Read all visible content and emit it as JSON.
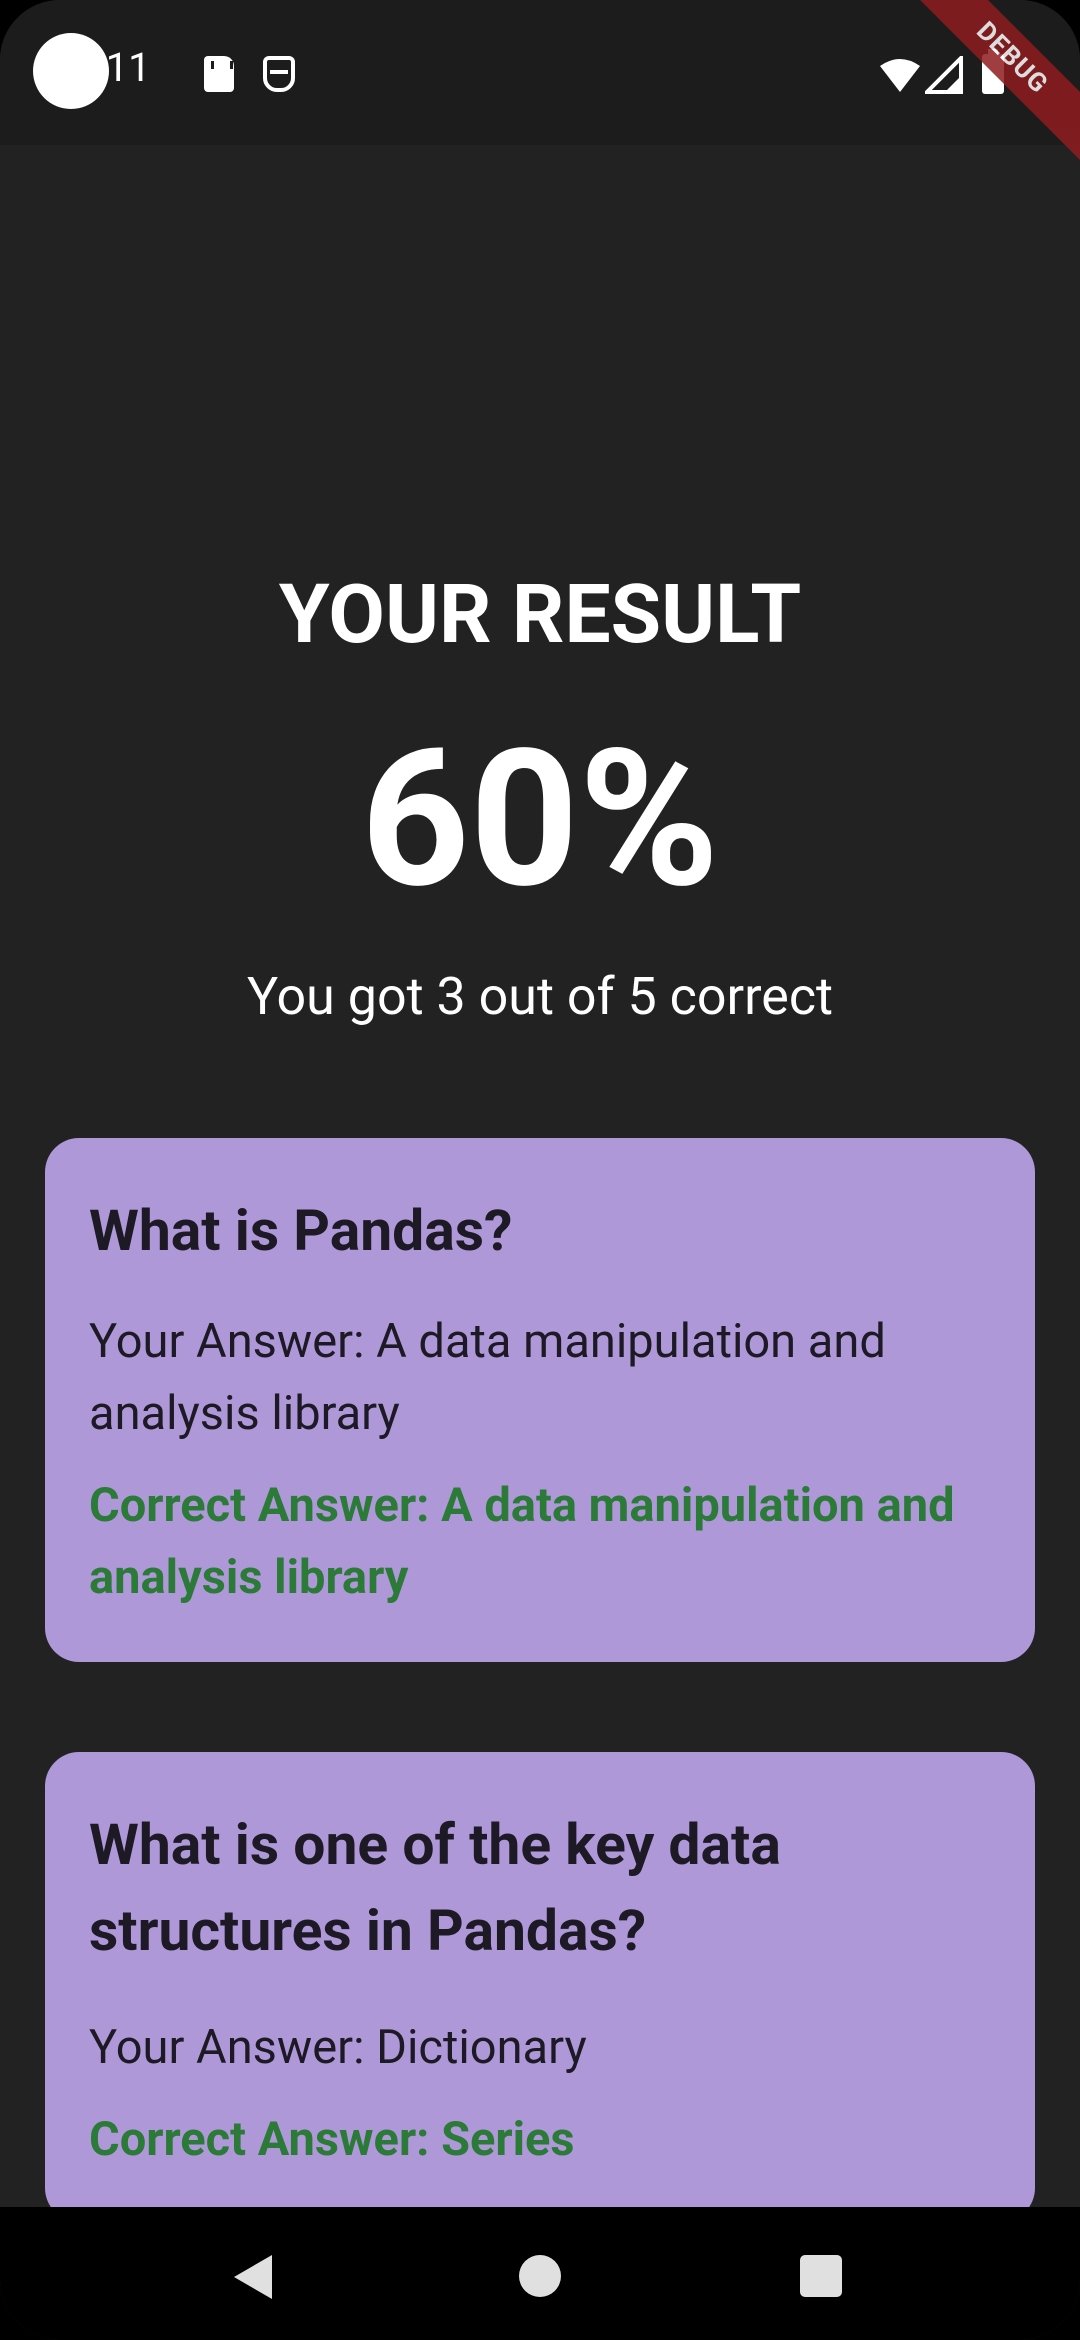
{
  "status_bar": {
    "time": ":11",
    "debug_label": "DEBUG"
  },
  "result": {
    "title": "YOUR RESULT",
    "percent": "60%",
    "summary": "You got 3 out of 5 correct"
  },
  "answers": [
    {
      "question": "What is Pandas?",
      "user_answer": "Your Answer: A data manipulation and analysis library",
      "correct_answer": "Correct Answer: A data manipulation and analysis library"
    },
    {
      "question": "What is one of the key data structures in Pandas?",
      "user_answer": "Your Answer: Dictionary",
      "correct_answer": "Correct Answer: Series"
    }
  ],
  "colors": {
    "background": "#222222",
    "card": "#ae98d8",
    "correct": "#2c7a37",
    "text_dark": "#1d1a26"
  }
}
